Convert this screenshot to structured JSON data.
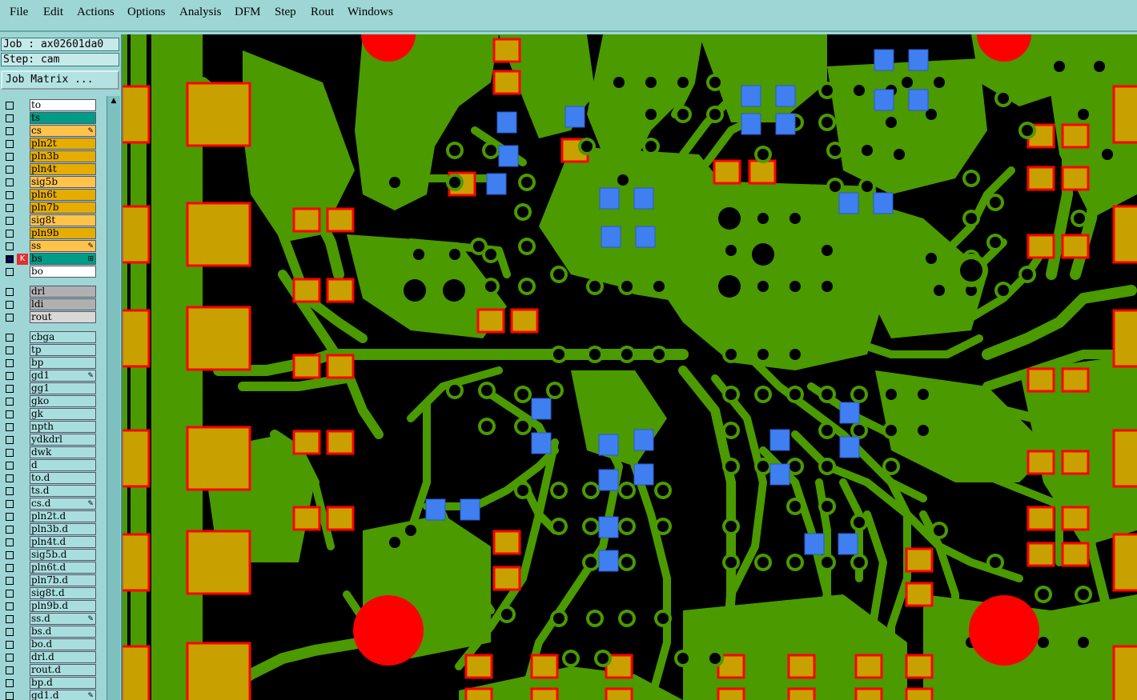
{
  "menu": [
    "File",
    "Edit",
    "Actions",
    "Options",
    "Analysis",
    "DFM",
    "Step",
    "Rout",
    "Windows"
  ],
  "job_line": "Job : ax02601da0",
  "step_line": "Step: cam",
  "job_matrix_button": "Job Matrix ...",
  "scroll_up_icon": "▲",
  "layers": [
    {
      "name": "to",
      "color": "#ffffff"
    },
    {
      "name": "ts",
      "color": "#009c88"
    },
    {
      "name": "cs",
      "color": "#ffc34a",
      "mark": "pencil-icon"
    },
    {
      "name": "pln2t",
      "color": "#e6ac00"
    },
    {
      "name": "pln3b",
      "color": "#e6ac00"
    },
    {
      "name": "pln4t",
      "color": "#e6ac00"
    },
    {
      "name": "sig5b",
      "color": "#ffc34a"
    },
    {
      "name": "pln6t",
      "color": "#e6ac00"
    },
    {
      "name": "pln7b",
      "color": "#e6ac00"
    },
    {
      "name": "sig8t",
      "color": "#ffc34a"
    },
    {
      "name": "pln9b",
      "color": "#e6ac00"
    },
    {
      "name": "ss",
      "color": "#ffc34a",
      "mark": "pencil-icon"
    },
    {
      "name": "bs",
      "color": "#009c88",
      "mark": "grid-icon",
      "active": true
    },
    {
      "name": "bo",
      "color": "#ffffff"
    },
    {
      "name": "drl",
      "color": "#b0b0b0"
    },
    {
      "name": "ldi",
      "color": "#b0b0b0"
    },
    {
      "name": "rout",
      "color": "#d8d8d8"
    },
    {
      "name": "cbga",
      "color": "#a8dede"
    },
    {
      "name": "tp",
      "color": "#a8dede"
    },
    {
      "name": "bp",
      "color": "#a8dede"
    },
    {
      "name": "gd1",
      "color": "#a8dede",
      "mark": "pencil-icon"
    },
    {
      "name": "gg1",
      "color": "#a8dede"
    },
    {
      "name": "gko",
      "color": "#a8dede"
    },
    {
      "name": "gk",
      "color": "#a8dede"
    },
    {
      "name": "npth",
      "color": "#a8dede"
    },
    {
      "name": "ydkdrl",
      "color": "#a8dede"
    },
    {
      "name": "dwk",
      "color": "#a8dede"
    },
    {
      "name": "d",
      "color": "#a8dede"
    },
    {
      "name": "to.d",
      "color": "#a8dede"
    },
    {
      "name": "ts.d",
      "color": "#a8dede"
    },
    {
      "name": "cs.d",
      "color": "#a8dede",
      "mark": "pencil-icon"
    },
    {
      "name": "pln2t.d",
      "color": "#a8dede"
    },
    {
      "name": "pln3b.d",
      "color": "#a8dede"
    },
    {
      "name": "pln4t.d",
      "color": "#a8dede"
    },
    {
      "name": "sig5b.d",
      "color": "#a8dede"
    },
    {
      "name": "pln6t.d",
      "color": "#a8dede"
    },
    {
      "name": "pln7b.d",
      "color": "#a8dede"
    },
    {
      "name": "sig8t.d",
      "color": "#a8dede"
    },
    {
      "name": "pln9b.d",
      "color": "#a8dede"
    },
    {
      "name": "ss.d",
      "color": "#a8dede",
      "mark": "pencil-icon"
    },
    {
      "name": "bs.d",
      "color": "#a8dede"
    },
    {
      "name": "bo.d",
      "color": "#a8dede"
    },
    {
      "name": "drl.d",
      "color": "#a8dede"
    },
    {
      "name": "rout.d",
      "color": "#a8dede"
    },
    {
      "name": "bp.d",
      "color": "#a8dede"
    },
    {
      "name": "gd1.d",
      "color": "#a8dede",
      "mark": "pencil-icon"
    }
  ],
  "colors": {
    "board_bg": "#000000",
    "copper": "#4b9a00",
    "pad_outline": "#ff0000",
    "pad_fill": "#c8a000",
    "smd_pad": "#3f7ff0",
    "fiducial": "#ff0000"
  }
}
